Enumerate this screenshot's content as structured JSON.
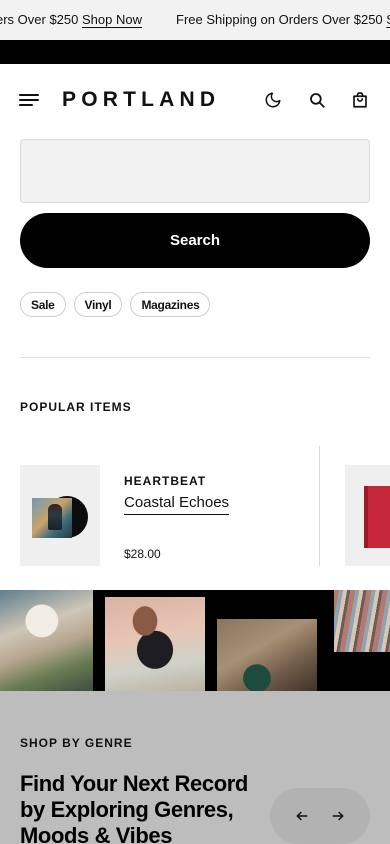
{
  "announcement": {
    "left_text": "ers Over $250",
    "left_link": "Shop Now",
    "right_text": "Free Shipping on Orders Over $250",
    "right_link": "S"
  },
  "header": {
    "logo": "PORTLAND",
    "icons": [
      "menu-icon",
      "moon-icon",
      "search-icon",
      "bag-icon"
    ]
  },
  "search": {
    "value": "",
    "placeholder": "",
    "button_label": "Search"
  },
  "tags": [
    "Sale",
    "Vinyl",
    "Magazines"
  ],
  "popular": {
    "title": "POPULAR ITEMS",
    "items": [
      {
        "brand": "HEARTBEAT",
        "title": "Coastal Echoes",
        "price": "$28.00"
      }
    ]
  },
  "genre": {
    "label": "SHOP BY GENRE",
    "heading": "Find Your Next Record by Exploring Genres, Moods & Vibes"
  },
  "colors": {
    "black": "#000000",
    "light_gray": "#f2f2f2",
    "genre_bg": "#bdbdbd"
  }
}
